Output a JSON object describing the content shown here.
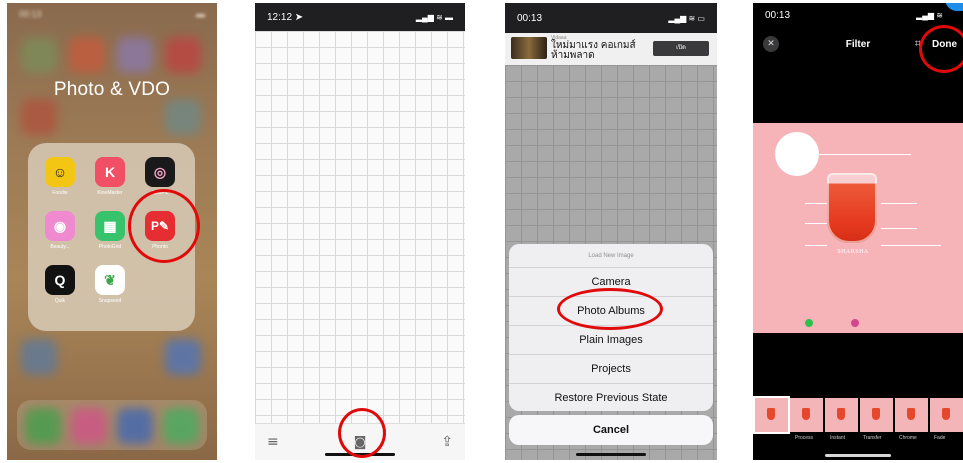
{
  "panel1": {
    "status_time": "00:13",
    "folder_title": "Photo & VDO",
    "apps": [
      {
        "label": "Foodie",
        "glyph": "☺",
        "color": "#f3c614",
        "icon": "foodie-icon"
      },
      {
        "label": "KineMaster",
        "glyph": "K",
        "color": "#f14f65",
        "icon": "kinemaster-icon"
      },
      {
        "label": "SplitPic",
        "glyph": "◎",
        "color": "#1a1a1a",
        "icon": "splitpic-icon"
      },
      {
        "label": "Beauty...",
        "glyph": "◉",
        "color": "#f08ad0",
        "icon": "beautyplus-icon"
      },
      {
        "label": "PhotoGrid",
        "glyph": "▦",
        "color": "#37c36b",
        "icon": "photogrid-icon"
      },
      {
        "label": "Phonto",
        "glyph": "P✎",
        "color": "#e52d32",
        "icon": "phonto-icon"
      },
      {
        "label": "Quik",
        "glyph": "Q",
        "color": "#111111",
        "icon": "quik-icon"
      },
      {
        "label": "Snapseed",
        "glyph": "❦",
        "color": "#ffffff",
        "icon": "snapseed-icon"
      }
    ],
    "highlight_color": "#e10a0a"
  },
  "panel2": {
    "status_time": "12:12 ➤",
    "status_icons": "▂▄▆ ≋ ▬",
    "menu_glyph": "≡",
    "camera_glyph": "◙",
    "share_glyph": "⇪"
  },
  "panel3": {
    "status_time": "00:13",
    "status_icons": "▂▄▆ ≋ ▭",
    "ad": {
      "tag": "Vidaaa",
      "text_line1": "ใหม่มาแรง คอเกมส์",
      "text_line2": "ห้ามพลาด",
      "button": "เปิด"
    },
    "sheet_title": "Load New Image",
    "options": [
      "Camera",
      "Photo Albums",
      "Plain Images",
      "Projects",
      "Restore Previous State"
    ],
    "cancel": "Cancel"
  },
  "panel4": {
    "status_time": "00:13",
    "status_icons": "▂▄▆ ≋",
    "title": "Filter",
    "done": "Done",
    "close_glyph": "✕",
    "crop_glyph": "⌗",
    "brand": "SHARSHA",
    "filters": [
      "Process",
      "Instant",
      "Transfer",
      "Chrome",
      "Fade"
    ]
  }
}
